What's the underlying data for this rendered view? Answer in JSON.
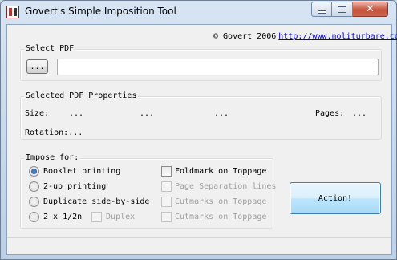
{
  "window": {
    "title": "Govert's Simple Imposition Tool"
  },
  "header": {
    "copyright": "© Govert 2006",
    "link": "http://www.noliturbare.com"
  },
  "select_pdf": {
    "legend": "Select PDF",
    "browse_label": "...",
    "path_value": ""
  },
  "properties": {
    "legend": "Selected PDF Properties",
    "size_label": "Size:",
    "size_value_1": "...",
    "size_value_2": "...",
    "size_value_3": "...",
    "pages_label": "Pages:",
    "pages_value": "...",
    "rotation_label": "Rotation:",
    "rotation_value": "..."
  },
  "impose": {
    "legend": "Impose for:",
    "options": [
      {
        "label": "Booklet printing",
        "selected": true
      },
      {
        "label": "2-up printing",
        "selected": false
      },
      {
        "label": "Duplicate side-by-side",
        "selected": false
      },
      {
        "label": "2 x 1/2n",
        "selected": false
      }
    ],
    "duplex_label": "Duplex",
    "checks": [
      {
        "label": "Foldmark on Toppage",
        "enabled": true,
        "checked": false
      },
      {
        "label": "Page Separation lines",
        "enabled": false,
        "checked": false
      },
      {
        "label": "Cutmarks on Toppage",
        "enabled": false,
        "checked": false
      },
      {
        "label": "Cutmarks on Toppage",
        "enabled": false,
        "checked": false
      }
    ]
  },
  "action": {
    "label": "Action!"
  },
  "status": {
    "text": ""
  }
}
